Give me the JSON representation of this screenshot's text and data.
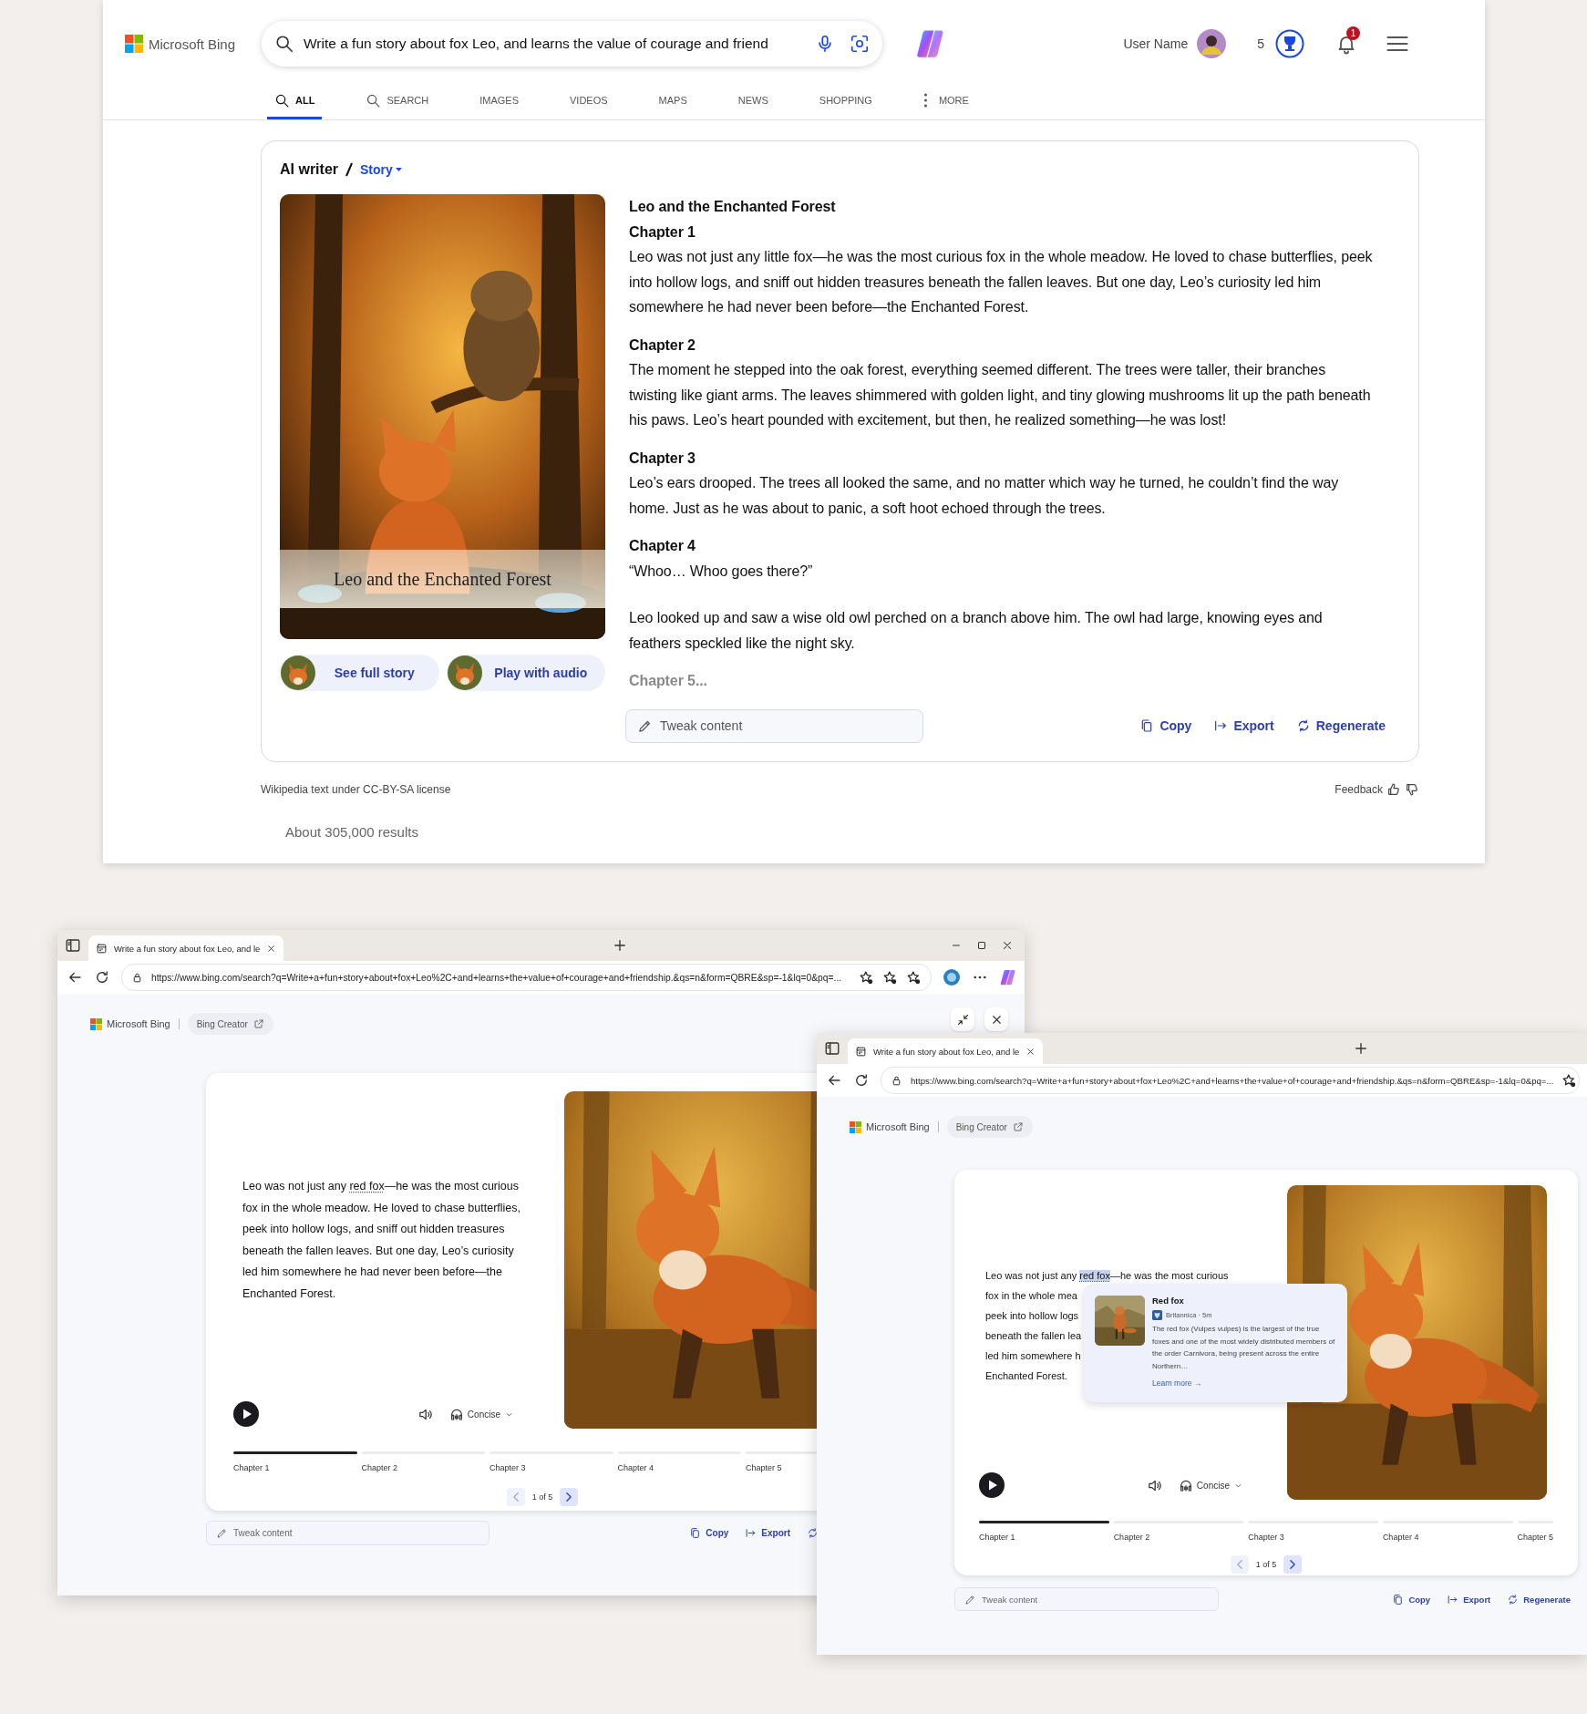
{
  "results_page": {
    "logo": "Microsoft Bing",
    "search": {
      "value": "Write a fun story about fox Leo, and learns the value of courage and friend"
    },
    "user_name": "User Name",
    "points": "5",
    "notifications": "1",
    "tabs": [
      {
        "label": "ALL",
        "selected": true
      },
      {
        "label": "SEARCH",
        "selected": false
      },
      {
        "label": "IMAGES",
        "selected": false
      },
      {
        "label": "VIDEOS",
        "selected": false
      },
      {
        "label": "MAPS",
        "selected": false
      },
      {
        "label": "NEWS",
        "selected": false
      },
      {
        "label": "SHOPPING",
        "selected": false
      },
      {
        "label": "MORE",
        "selected": false
      }
    ],
    "card": {
      "title": "AI writer",
      "mode": "Story",
      "cover_caption": "Leo and the Enchanted Forest",
      "actions": [
        {
          "label": "See full story"
        },
        {
          "label": "Play with audio"
        }
      ],
      "story": [
        {
          "kind": "title",
          "text": "Leo and the Enchanted Forest"
        },
        {
          "kind": "heading",
          "text": "Chapter 1"
        },
        {
          "kind": "paragraph",
          "text": "Leo was not just any little fox—he was the most curious fox in the whole meadow. He loved to chase butterflies, peek into hollow logs, and sniff out hidden treasures beneath the fallen leaves. But one day, Leo’s curiosity led him somewhere he had never been before—the Enchanted Forest."
        },
        {
          "kind": "heading",
          "text": "Chapter 2"
        },
        {
          "kind": "paragraph",
          "text": "The moment he stepped into the oak forest, everything seemed different. The trees were taller, their branches twisting like giant arms. The leaves shimmered with golden light, and tiny glowing mushrooms lit up the path beneath his paws. Leo’s heart pounded with excitement, but then, he realized something—he was lost!"
        },
        {
          "kind": "heading",
          "text": "Chapter 3"
        },
        {
          "kind": "paragraph",
          "text": "Leo’s ears drooped. The trees all looked the same, and no matter which way he turned, he couldn’t find the way home. Just as he was about to panic, a soft hoot echoed through the trees."
        },
        {
          "kind": "heading",
          "text": "Chapter 4"
        },
        {
          "kind": "paragraph",
          "text": "“Whoo… Whoo goes there?”"
        },
        {
          "kind": "paragraph",
          "text": "Leo looked up and saw a wise old owl perched on a branch above him. The owl had large, knowing eyes and feathers speckled like the night sky."
        },
        {
          "kind": "fade",
          "text": "Chapter 5..."
        }
      ],
      "tweak": {
        "placeholder": "Tweak content"
      },
      "tools": [
        {
          "kind": "copy",
          "label": "Copy"
        },
        {
          "kind": "export",
          "label": "Export"
        },
        {
          "kind": "regenerate",
          "label": "Regenerate"
        }
      ]
    },
    "license": "Wikipedia text under CC-BY-SA license",
    "feedback": "Feedback",
    "result_count": "About 305,000 results"
  },
  "windows": [
    {
      "tab_title": "Write a fun story about fox Leo, and le",
      "url": "https://www.bing.com/search?q=Write+a+fun+story+about+fox+Leo%2C+and+learns+the+value+of+courage+and+friendship.&qs=n&form=QBRE&sp=-1&lq=0&pq=...",
      "window_controls": [
        {
          "kind": "minimize"
        },
        {
          "kind": "maximize"
        },
        {
          "kind": "close"
        }
      ],
      "toolbar": [
        {
          "kind": "add-favorite"
        },
        {
          "kind": "favorites"
        },
        {
          "kind": "collections"
        },
        {
          "kind": "profile"
        },
        {
          "kind": "more"
        },
        {
          "kind": "copilot"
        }
      ],
      "logo": "Microsoft Bing",
      "creator": "Bing Creator",
      "panel_buttons": [
        {
          "kind": "collapse"
        },
        {
          "kind": "close"
        }
      ],
      "reader": {
        "lines": [
          {
            "text": "Leo was not just any ",
            "link": "red fox",
            "link_selected": false,
            "after": "—he was the most curious"
          },
          {
            "text": "fox in the whole meadow. He loved to chase butterflies,"
          },
          {
            "text": "peek into hollow logs, and sniff out hidden treasures"
          },
          {
            "text": "beneath the fallen leaves. But one day, Leo’s curiosity"
          },
          {
            "text": "led him somewhere he had never been before—the"
          },
          {
            "text": "Enchanted Forest."
          }
        ],
        "voice": "Concise",
        "chapters": [
          {
            "label": "Chapter 1",
            "level": 1
          },
          {
            "label": "Chapter 2",
            "level": 0
          },
          {
            "label": "Chapter 3",
            "level": 0
          },
          {
            "label": "Chapter 4",
            "level": 0
          },
          {
            "label": "Chapter 5",
            "level": 0
          }
        ],
        "pager": {
          "text": "1 of 5",
          "prev_disabled": true,
          "next_disabled": false
        }
      },
      "tweak": {
        "placeholder": "Tweak content"
      },
      "tools": [
        {
          "kind": "copy",
          "label": "Copy"
        },
        {
          "kind": "export",
          "label": "Export"
        },
        {
          "kind": "regenerate"
        }
      ]
    },
    {
      "tab_title": "Write a fun story about fox Leo, and le",
      "url": "https://www.bing.com/search?q=Write+a+fun+story+about+fox+Leo%2C+and+learns+the+value+of+courage+and+friendship.&qs=n&form=QBRE&sp=-1&lq=0&pq=...",
      "toolbar": [
        {
          "kind": "add-favorite"
        }
      ],
      "logo": "Microsoft Bing",
      "creator": "Bing Creator",
      "reader": {
        "lines": [
          {
            "text": "Leo was not just any ",
            "link": "red fox",
            "link_selected": true,
            "after": "—he was the most curious"
          },
          {
            "text": "fox in the whole mea"
          },
          {
            "text": "peek into hollow logs"
          },
          {
            "text": "beneath the fallen lea"
          },
          {
            "text": "led him somewhere h"
          },
          {
            "text": "Enchanted Forest."
          }
        ],
        "voice": "Concise",
        "chapters": [
          {
            "label": "Chapter 1",
            "level": 1
          },
          {
            "label": "Chapter 2",
            "level": 0
          },
          {
            "label": "Chapter 3",
            "level": 0
          },
          {
            "label": "Chapter 4",
            "level": 0
          },
          {
            "label": "Chapter 5",
            "level": 0
          }
        ],
        "pager": {
          "text": "1 of 5",
          "prev_disabled": true,
          "next_disabled": false
        }
      },
      "popup": {
        "title": "Red fox",
        "source": "Britannica · 5m",
        "text": "The red fox (Vulpes vulpes) is the largest of the true foxes and one of the most widely distributed members of the order Carnivora, being present across the entire Northern…",
        "link": "Learn more →"
      },
      "tweak": {
        "placeholder": "Tweak content"
      },
      "tools": [
        {
          "kind": "copy",
          "label": "Copy"
        },
        {
          "kind": "export",
          "label": "Export"
        },
        {
          "kind": "regenerate",
          "label": "Regenerate"
        }
      ]
    }
  ]
}
